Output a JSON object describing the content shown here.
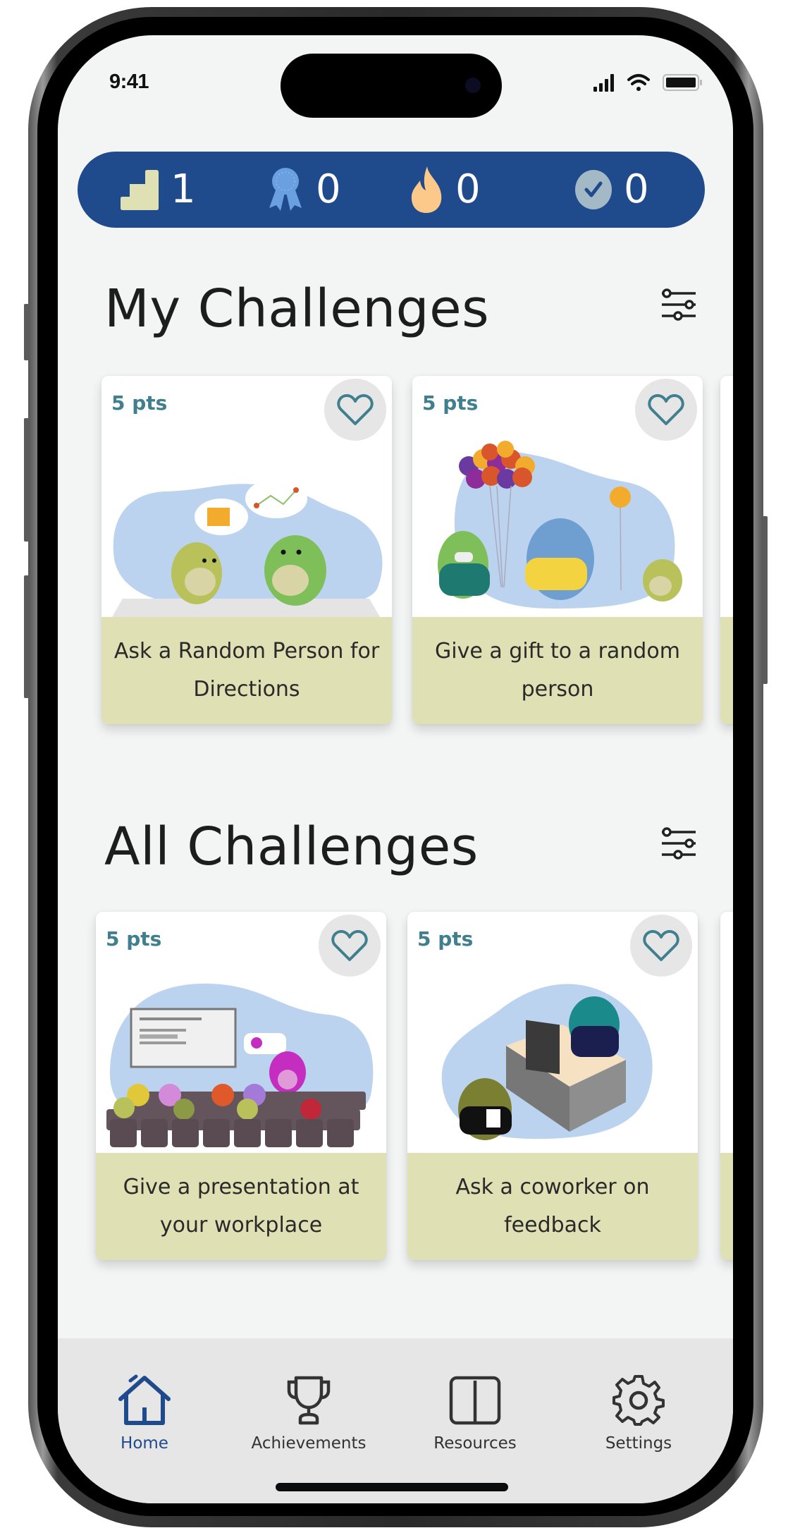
{
  "status_bar": {
    "time": "9:41",
    "icons": [
      "cellular-signal-icon",
      "wifi-icon",
      "battery-icon"
    ]
  },
  "stats": [
    {
      "icon": "stairs-level-icon",
      "value": "1",
      "color": "#dfe0b3"
    },
    {
      "icon": "ribbon-badge-icon",
      "value": "0",
      "color": "#6a9fe0"
    },
    {
      "icon": "flame-streak-icon",
      "value": "0",
      "color": "#fcc98a"
    },
    {
      "icon": "check-circle-icon",
      "value": "0",
      "color": "#a3b9c6"
    }
  ],
  "my_challenges": {
    "title": "My Challenges",
    "filter_icon": "sliders-filter-icon",
    "cards": [
      {
        "points": "5 pts",
        "title": "Ask a Random Person for Directions",
        "illustration": "two dinos asking directions"
      },
      {
        "points": "5 pts",
        "title": "Give a gift to a random person",
        "illustration": "dino giving balloons"
      }
    ]
  },
  "all_challenges": {
    "title": "All Challenges",
    "filter_icon": "sliders-filter-icon",
    "cards": [
      {
        "points": "5 pts",
        "title": "Give a presentation at your workplace",
        "illustration": "dino presenting to audience"
      },
      {
        "points": "5 pts",
        "title": "Ask a coworker on feedback",
        "illustration": "dino at office desk"
      }
    ]
  },
  "nav": {
    "items": [
      {
        "label": "Home",
        "icon": "home-icon",
        "active": true
      },
      {
        "label": "Achievements",
        "icon": "trophy-icon",
        "active": false
      },
      {
        "label": "Resources",
        "icon": "book-icon",
        "active": false
      },
      {
        "label": "Settings",
        "icon": "gear-icon",
        "active": false
      }
    ]
  },
  "colors": {
    "brand_blue": "#1f4a8c",
    "points_teal": "#3f7f8e",
    "card_caption_bg": "#dfe0b3",
    "illustration_blob": "#bcd3f0"
  }
}
